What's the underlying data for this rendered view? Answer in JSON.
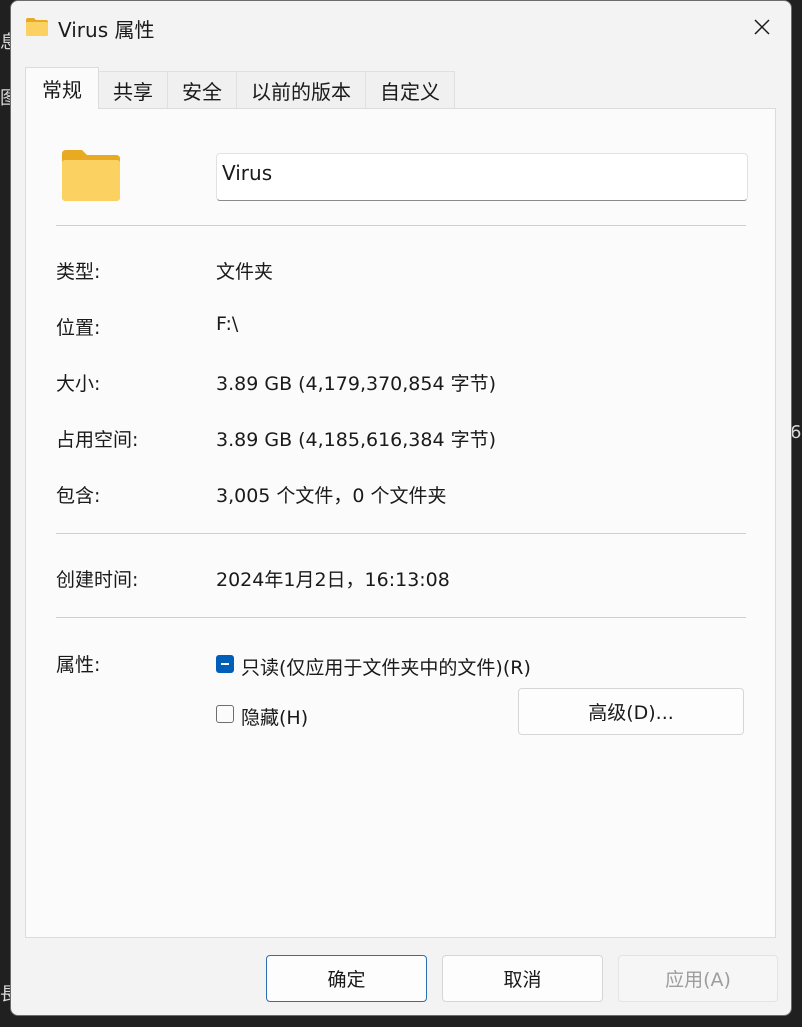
{
  "window": {
    "title": "Virus 属性",
    "close_icon": "close-icon"
  },
  "tabs": [
    {
      "label": "常规",
      "active": true
    },
    {
      "label": "共享",
      "active": false
    },
    {
      "label": "安全",
      "active": false
    },
    {
      "label": "以前的版本",
      "active": false
    },
    {
      "label": "自定义",
      "active": false
    }
  ],
  "general": {
    "folder_icon": "folder-icon",
    "name_value": "Virus",
    "properties": [
      {
        "label": "类型:",
        "value": "文件夹"
      },
      {
        "label": "位置:",
        "value": "F:\\"
      },
      {
        "label": "大小:",
        "value": "3.89 GB (4,179,370,854 字节)"
      },
      {
        "label": "占用空间:",
        "value": "3.89 GB (4,185,616,384 字节)"
      },
      {
        "label": "包含:",
        "value": "3,005 个文件，0 个文件夹"
      }
    ],
    "created": {
      "label": "创建时间:",
      "value": "2024年1月2日，16:13:08"
    },
    "attributes": {
      "label": "属性:",
      "readonly_label": "只读(仅应用于文件夹中的文件)(R)",
      "readonly_state": "indeterminate",
      "hidden_label": "隐藏(H)",
      "hidden_state": "unchecked",
      "advanced_button": "高级(D)..."
    }
  },
  "buttons": {
    "ok": "确定",
    "cancel": "取消",
    "apply": "应用(A)"
  },
  "colors": {
    "accent": "#005fb8",
    "folder": "#f9c94a"
  }
}
